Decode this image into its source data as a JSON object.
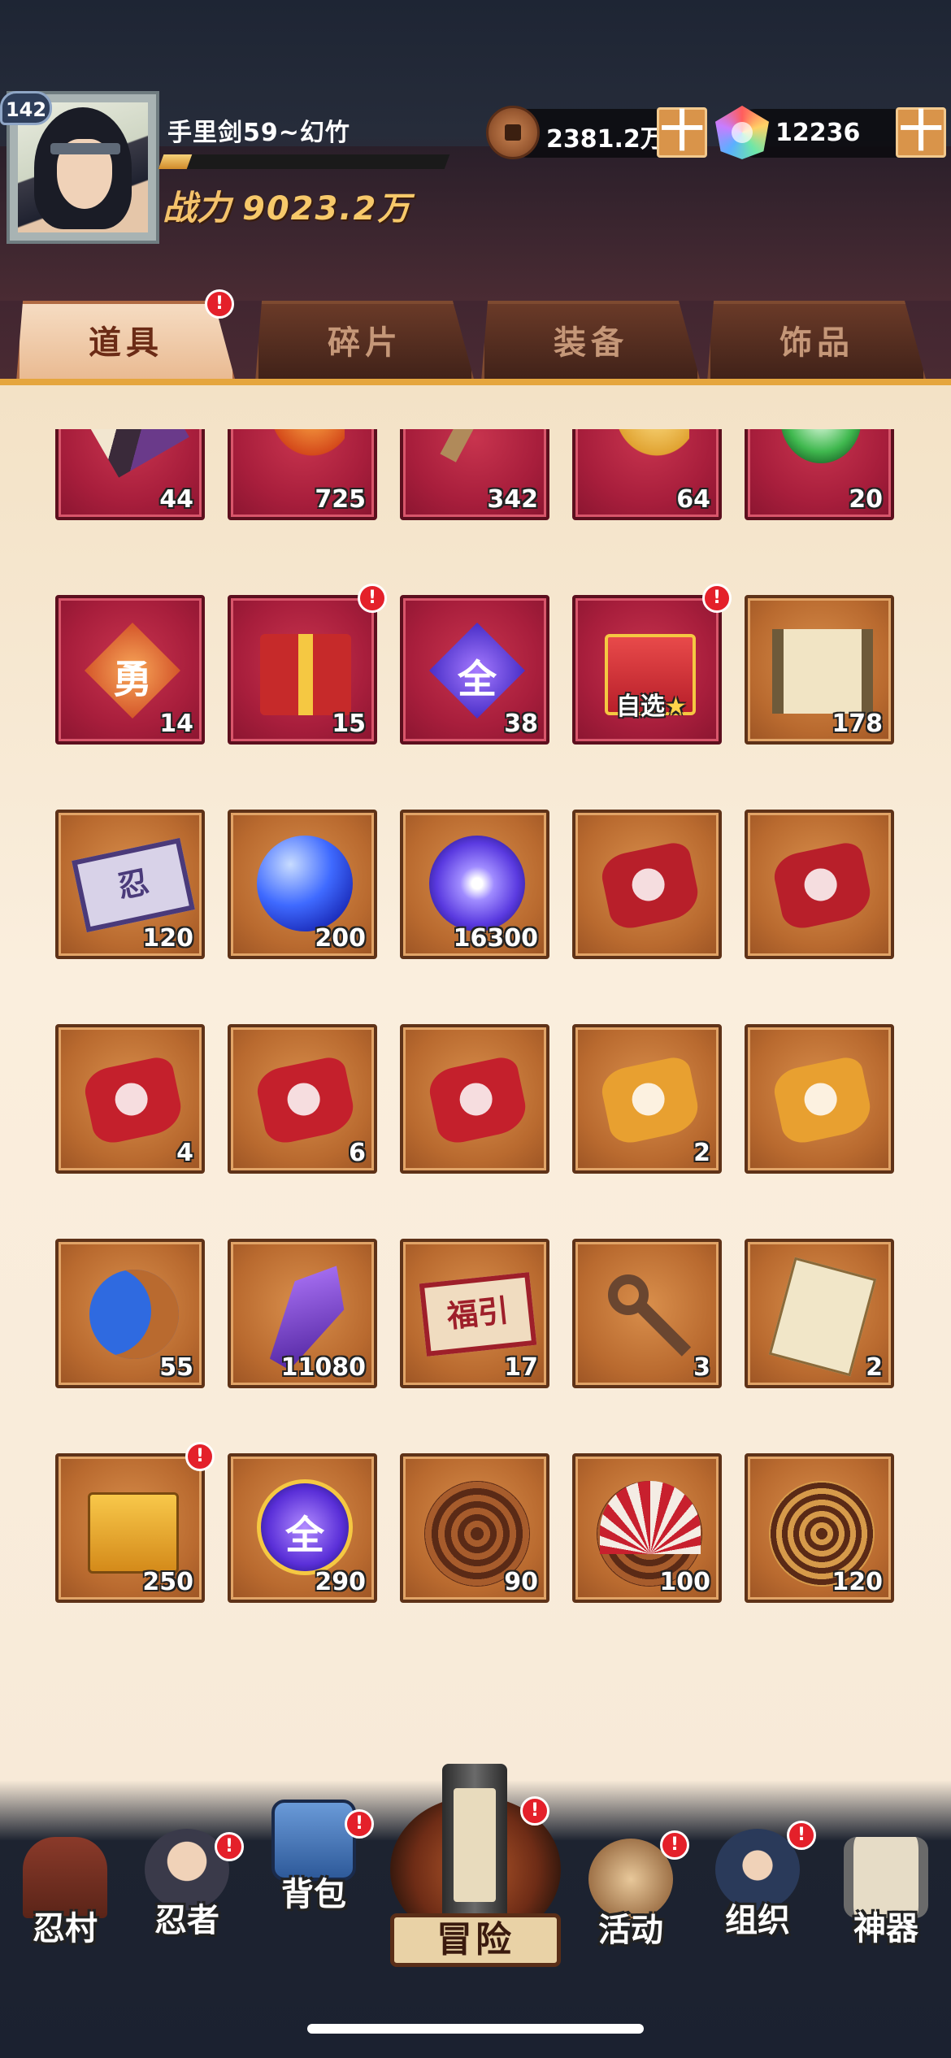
{
  "player": {
    "level": "142",
    "name": "手里剑59~幻竹",
    "power_label": "战力",
    "power_value": "9023.2万",
    "exp_fraction": 0.1
  },
  "currency": {
    "copper": "2381.2万",
    "gems": "12236",
    "plus": "十"
  },
  "tabs": [
    {
      "label": "道具",
      "active": true,
      "alert": true
    },
    {
      "label": "碎片",
      "active": false,
      "alert": false
    },
    {
      "label": "装备",
      "active": false,
      "alert": false
    },
    {
      "label": "饰品",
      "active": false,
      "alert": false
    }
  ],
  "alert_mark": "!",
  "items": {
    "row0": [
      "44",
      "725",
      "342",
      "64",
      "20"
    ],
    "row1": [
      {
        "count": "14",
        "glyph": "勇"
      },
      {
        "count": "15"
      },
      {
        "count": "38",
        "glyph": "全"
      },
      {
        "tag": "自选",
        "star": "★"
      },
      {
        "count": "178"
      }
    ],
    "row2": [
      "120",
      "200",
      "16300",
      "",
      ""
    ],
    "row3": [
      "4",
      "6",
      "",
      "2",
      ""
    ],
    "row4": [
      "55",
      "11080",
      "17",
      "3",
      "2"
    ],
    "row4_flag": "福引",
    "row5": [
      "250",
      "290",
      "90",
      "100",
      "120"
    ],
    "row5_glyph": "全",
    "row2_card_glyph": "忍"
  },
  "nav": {
    "village": "忍村",
    "ninja": "忍者",
    "bag": "背包",
    "adventure": "冒险",
    "event": "活动",
    "org": "组织",
    "artifact": "神器"
  },
  "colors": {
    "accent": "#e5a63e",
    "alert": "#e4202a",
    "red_slot": "#a81e3c",
    "brown_slot": "#b96a2f"
  }
}
